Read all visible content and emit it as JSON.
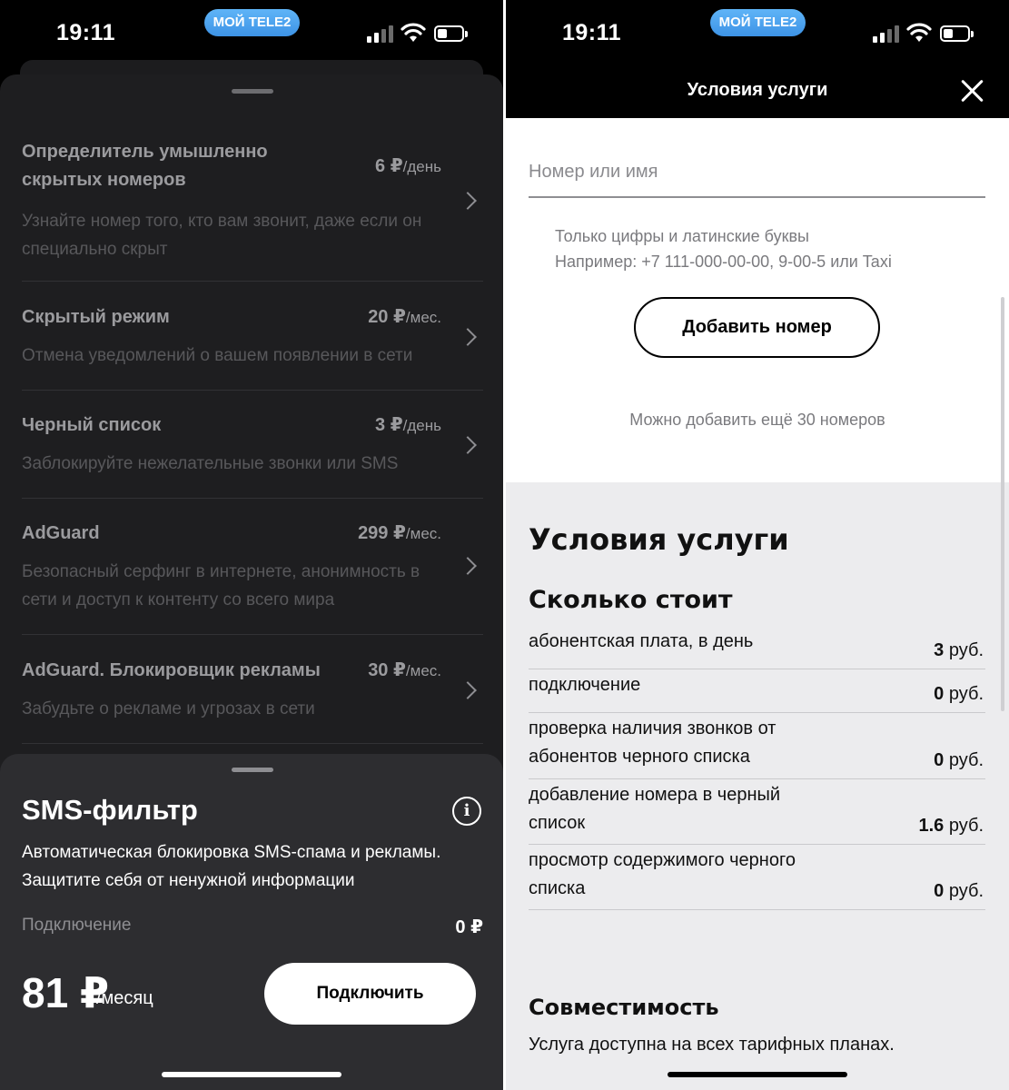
{
  "status": {
    "time": "19:11",
    "carrier_pill": "МОЙ TELE2"
  },
  "left": {
    "services": [
      {
        "name": "Определитель умышленно скрытых номеров",
        "price": "6 ₽",
        "unit": "/день",
        "desc": "Узнайте номер того, кто вам звонит, даже если он специально скрыт"
      },
      {
        "name": "Скрытый режим",
        "price": "20 ₽",
        "unit": "/мес.",
        "desc": "Отмена уведомлений о вашем появлении в сети"
      },
      {
        "name": "Черный список",
        "price": "3 ₽",
        "unit": "/день",
        "desc": "Заблокируйте нежелательные звонки или SMS"
      },
      {
        "name": "AdGuard",
        "price": "299 ₽",
        "unit": "/мес.",
        "desc": "Безопасный серфинг в интернете, анонимность в сети и доступ к контенту со всего мира"
      },
      {
        "name": "AdGuard. Блокировщик рекламы",
        "price": "30 ₽",
        "unit": "/мес.",
        "desc": "Забудьте о рекламе и угрозах в сети"
      }
    ],
    "sheet": {
      "title": "SMS-фильтр",
      "description": "Автоматическая блокировка SMS-спама и рекламы. Защитите себя от ненужной информации",
      "connection_label": "Подключение",
      "connection_value": "0 ₽",
      "price": "81 ₽",
      "price_unit": "/месяц",
      "connect_button": "Подключить"
    }
  },
  "right": {
    "header_title": "Условия услуги",
    "input_placeholder": "Номер или имя",
    "hint_line1": "Только цифры и латинские буквы",
    "hint_line2": "Например: +7 111-000-00-00, 9-00-5 или Taxi",
    "add_button": "Добавить номер",
    "remaining": "Можно добавить ещё 30 номеров",
    "conditions_title": "Условия услуги",
    "cost_title": "Сколько стоит",
    "costs": [
      {
        "label": "абонентская плата, в день",
        "value": "3",
        "unit": "руб."
      },
      {
        "label": "подключение",
        "value": "0",
        "unit": "руб."
      },
      {
        "label": "проверка наличия звонков от абонентов черного списка",
        "value": "0",
        "unit": "руб."
      },
      {
        "label": "добавление номера в черный список",
        "value": "1.6",
        "unit": "руб."
      },
      {
        "label": "просмотр содержимого черного списка",
        "value": "0",
        "unit": "руб."
      }
    ],
    "compat_title": "Совместимость",
    "compat_text": "Услуга доступна на всех тарифных планах."
  }
}
